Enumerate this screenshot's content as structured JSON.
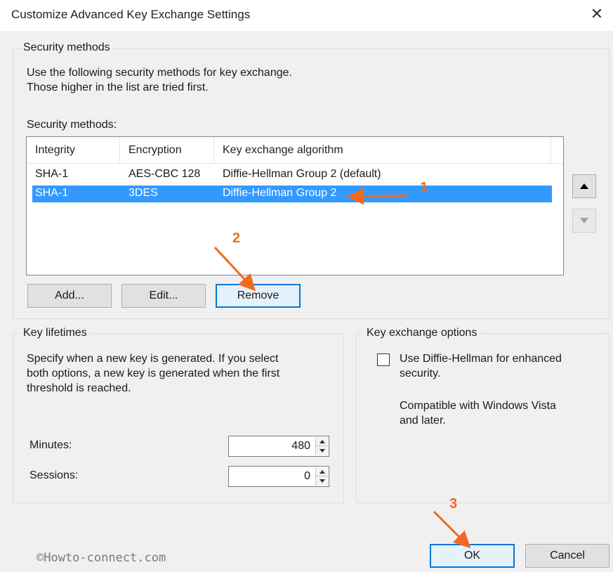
{
  "window": {
    "title": "Customize Advanced Key Exchange Settings",
    "close_glyph": "✕"
  },
  "security_methods": {
    "group_label": "Security methods",
    "description_line1": "Use the following security methods for key exchange.",
    "description_line2": "Those higher in the list are tried first.",
    "list_label": "Security methods:",
    "columns": [
      "Integrity",
      "Encryption",
      "Key exchange algorithm"
    ],
    "rows": [
      {
        "integrity": "SHA-1",
        "encryption": "AES-CBC 128",
        "algorithm": "Diffie-Hellman Group 2 (default)",
        "selected": false
      },
      {
        "integrity": "SHA-1",
        "encryption": "3DES",
        "algorithm": "Diffie-Hellman Group 2",
        "selected": true
      }
    ],
    "buttons": {
      "add": "Add...",
      "edit": "Edit...",
      "remove": "Remove"
    },
    "move_up_icon": "triangle-up-icon",
    "move_down_icon": "triangle-down-icon"
  },
  "key_lifetimes": {
    "group_label": "Key lifetimes",
    "description_line1": "Specify when a new key is generated. If you select",
    "description_line2": "both options, a new key is generated when the first",
    "description_line3": "threshold is reached.",
    "minutes_label": "Minutes:",
    "minutes_value": "480",
    "sessions_label": "Sessions:",
    "sessions_value": "0"
  },
  "key_exchange_options": {
    "group_label": "Key exchange options",
    "checkbox_checked": false,
    "checkbox_label_line1": "Use Diffie-Hellman for enhanced",
    "checkbox_label_line2": "security.",
    "note_line1": "Compatible with Windows Vista",
    "note_line2": "and later."
  },
  "footer": {
    "watermark": "©Howto-connect.com",
    "ok": "OK",
    "cancel": "Cancel"
  },
  "annotations": {
    "step1": "1",
    "step2": "2",
    "step3": "3",
    "color": "#f26a21"
  },
  "colors": {
    "selection": "#3399ff",
    "focus_border": "#0078d7",
    "background": "#f0f0f0"
  }
}
